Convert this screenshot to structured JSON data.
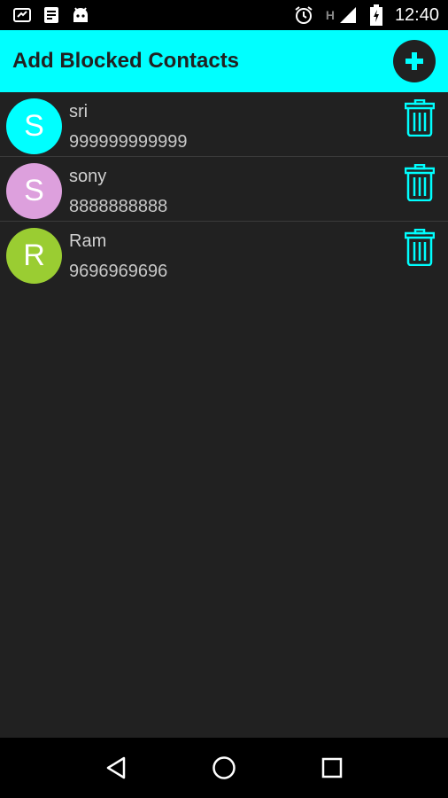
{
  "status_bar": {
    "time": "12:40",
    "network_label": "H",
    "left_icons": [
      "screen-share-icon",
      "notes-icon",
      "android-icon"
    ],
    "right_icons": [
      "alarm-icon",
      "signal-icon",
      "battery-charging-icon"
    ]
  },
  "app_bar": {
    "title": "Add Blocked Contacts",
    "add_icon": "plus-icon",
    "accent_color": "#00ffff"
  },
  "contacts": [
    {
      "initial": "S",
      "name": "sri",
      "number": "999999999999",
      "avatar_color": "#00ffff"
    },
    {
      "initial": "S",
      "name": "sony",
      "number": "8888888888",
      "avatar_color": "#dda0dd"
    },
    {
      "initial": "R",
      "name": "Ram",
      "number": "9696969696",
      "avatar_color": "#9acd32"
    }
  ],
  "nav_bar": {
    "icons": [
      "back-icon",
      "home-icon",
      "recents-icon"
    ]
  }
}
